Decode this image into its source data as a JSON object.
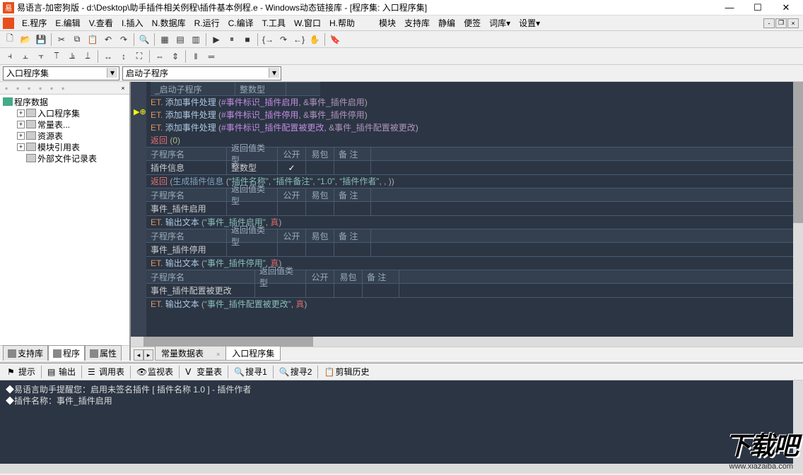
{
  "title": "易语言-加密狗版 - d:\\Desktop\\助手插件相关例程\\插件基本例程.e - Windows动态链接库 - [程序集: 入口程序集]",
  "menu": {
    "items": [
      "E.程序",
      "E.编辑",
      "V.查看",
      "I.插入",
      "N.数据库",
      "R.运行",
      "C.编译",
      "T.工具",
      "W.窗口",
      "H.帮助"
    ],
    "extras": [
      "模块",
      "支持库",
      "静编",
      "便签",
      "词库▾",
      "设置▾"
    ]
  },
  "combos": {
    "left": "入口程序集",
    "right": "启动子程序"
  },
  "tree": {
    "root": "程序数据",
    "children": [
      {
        "exp": "+",
        "label": "入口程序集"
      },
      {
        "exp": "+",
        "label": "常量表..."
      },
      {
        "exp": "+",
        "label": "资源表"
      },
      {
        "exp": "+",
        "label": "模块引用表"
      },
      {
        "exp": "",
        "label": "外部文件记录表"
      }
    ]
  },
  "leftTabs": [
    "支持库",
    "程序",
    "属性"
  ],
  "codeTabs": [
    {
      "label": "常量数据表",
      "active": false,
      "close": true
    },
    {
      "label": "入口程序集",
      "active": true,
      "close": false
    }
  ],
  "hdr": {
    "name": "子程序名",
    "ret": "返回值类型",
    "pub": "公开",
    "pkg": "易包",
    "note": "备 注"
  },
  "code": {
    "startSub": "_启动子程序",
    "startRet": "整数型",
    "et": "ET.",
    "addEvent": "添加事件处理",
    "const1": "#事件标识_插件启用",
    "arg1": "&事件_插件启用",
    "const2": "#事件标识_插件停用",
    "arg2": "&事件_插件停用",
    "const3": "#事件标识_插件配置被更改",
    "arg3": "&事件_插件配置被更改",
    "ret": "返回",
    "zero": "0",
    "infoName": "插件信息",
    "intType": "整数型",
    "genInfo": "生成插件信息",
    "s1": "“插件名称”",
    "s2": "“插件备注”",
    "s3": "“1.0”",
    "s4": "“插件作者”",
    "ev1": "事件_插件启用",
    "ev2": "事件_插件停用",
    "ev3": "事件_插件配置被更改",
    "output": "输出文本",
    "os1": "“事件_插件启用”",
    "os2": "“事件_插件停用”",
    "os3": "“事件_插件配置被更改”",
    "true": "真"
  },
  "bottomTabs": [
    "提示",
    "输出",
    "调用表",
    "监视表",
    "变量表",
    "搜寻1",
    "搜寻2",
    "剪辑历史"
  ],
  "output": {
    "l1": "易语言助手提醒您：启用未签名插件 [ 插件名称 1.0 ] - 插件作者",
    "l2": "插件名称：事件_插件启用"
  },
  "watermark": {
    "logo": "下载吧",
    "url": "www.xiazaiba.com"
  }
}
